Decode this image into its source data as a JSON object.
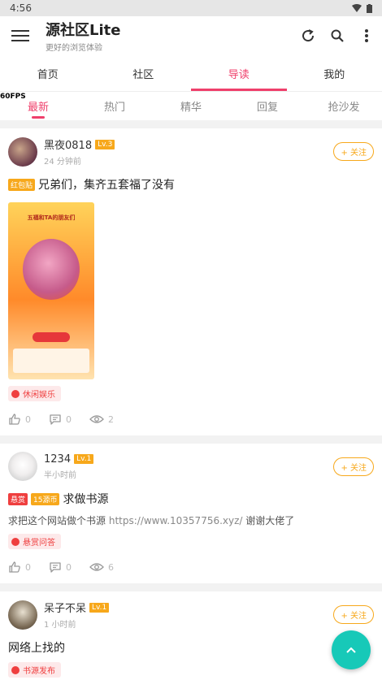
{
  "status": {
    "time": "4:56"
  },
  "appbar": {
    "title": "源社区Lite",
    "subtitle": "更好的浏览体验"
  },
  "tabs": [
    {
      "label": "首页"
    },
    {
      "label": "社区"
    },
    {
      "label": "导读"
    },
    {
      "label": "我的"
    }
  ],
  "fps": "60FPS",
  "subtabs": [
    {
      "label": "最新"
    },
    {
      "label": "热门"
    },
    {
      "label": "精华"
    },
    {
      "label": "回复"
    },
    {
      "label": "抢沙发"
    }
  ],
  "posts": [
    {
      "name": "黑夜0818",
      "level": "Lv.3",
      "time": "24 分钟前",
      "follow": "+ 关注",
      "tag": "红包贴",
      "title": "兄弟们，集齐五套福了没有",
      "image_text": "五福和TA的朋友们",
      "category": "休闲娱乐",
      "likes": "0",
      "comments": "0",
      "views": "2"
    },
    {
      "name": "1234",
      "level": "Lv.1",
      "time": "半小时前",
      "follow": "+ 关注",
      "tag": "悬赏",
      "coin": "15源币",
      "title": "求做书源",
      "desc": "求把这个网站做个书源",
      "url": "https://www.10357756.xyz/",
      "desc_tail": "谢谢大佬了",
      "category": "悬赏问答",
      "likes": "0",
      "comments": "0",
      "views": "6"
    },
    {
      "name": "呆子不呆",
      "level": "Lv.1",
      "time": "1 小时前",
      "follow": "+ 关注",
      "title": "网络上找的",
      "category": "书源发布"
    }
  ],
  "colors": {
    "accent": "#ef3f6b",
    "level": "#f7a81b",
    "fab": "#17c9b8"
  }
}
